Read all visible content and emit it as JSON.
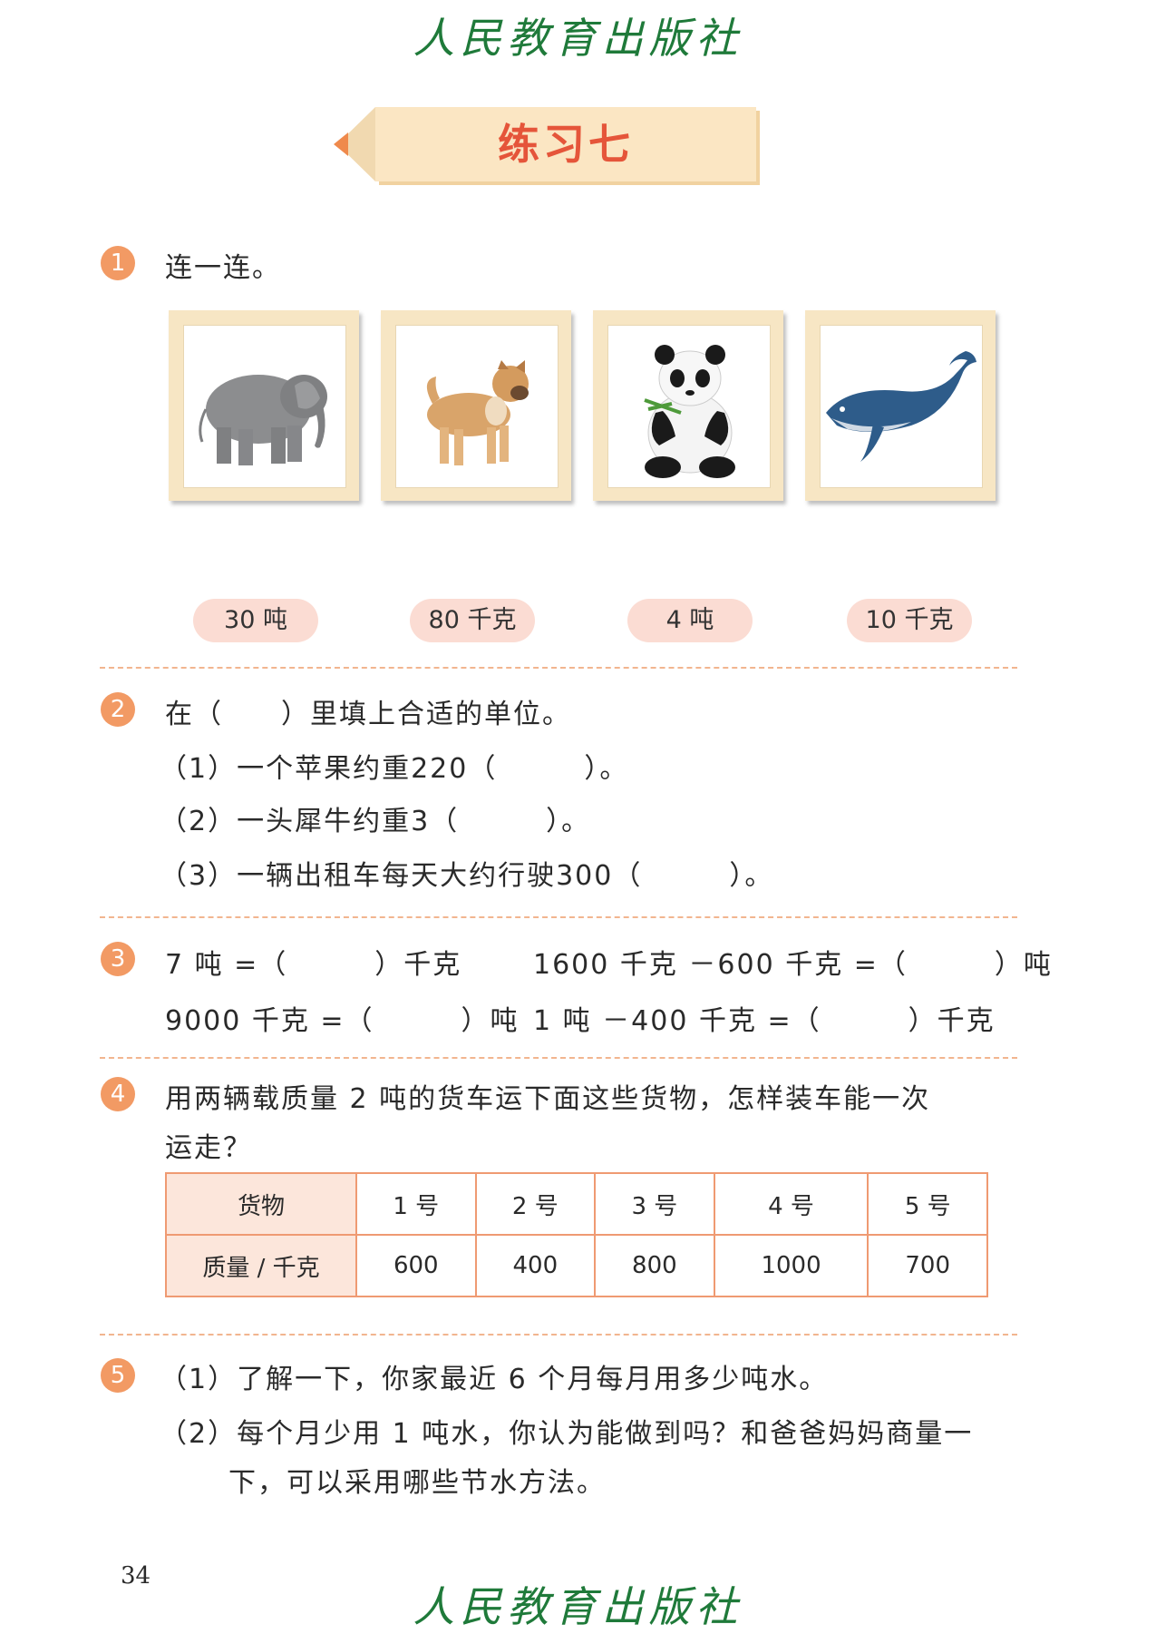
{
  "publisher": "人民教育出版社",
  "title": "练习七",
  "q1": {
    "num": "1",
    "instruction": "连一连。",
    "animals": [
      "elephant",
      "dog",
      "panda",
      "whale"
    ],
    "weights": [
      "30 吨",
      "80 千克",
      "4 吨",
      "10 千克"
    ]
  },
  "q2": {
    "num": "2",
    "instruction": "在（　　）里填上合适的单位。",
    "items": [
      "（1）一个苹果约重220（　　　）。",
      "（2）一头犀牛约重3（　　　）。",
      "（3）一辆出租车每天大约行驶300（　　　）。"
    ]
  },
  "q3": {
    "num": "3",
    "eq1": "7 吨 =（　　　）千克",
    "eq2": "1600 千克 －600 千克 =（　　　）吨",
    "eq3": "9000 千克 =（　　　）吨",
    "eq4": "1 吨 －400 千克 =（　　　）千克"
  },
  "q4": {
    "num": "4",
    "line1": "用两辆载质量 2 吨的货车运下面这些货物，怎样装车能一次",
    "line2": "运走？",
    "table": {
      "row1_label": "货物",
      "row2_label": "质量 / 千克",
      "items": [
        "1 号",
        "2 号",
        "3 号",
        "4 号",
        "5 号"
      ],
      "weights": [
        "600",
        "400",
        "800",
        "1000",
        "700"
      ]
    }
  },
  "q5": {
    "num": "5",
    "line1": "（1）了解一下，你家最近 6 个月每月用多少吨水。",
    "line2": "（2）每个月少用 1 吨水，你认为能做到吗？和爸爸妈妈商量一",
    "line3": "下，可以采用哪些节水方法。"
  },
  "page_number": "34"
}
